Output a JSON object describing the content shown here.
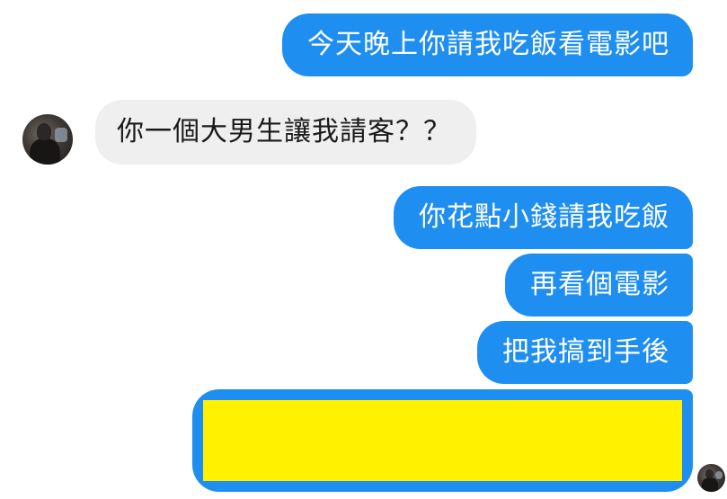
{
  "conversation": {
    "messages": [
      {
        "side": "outgoing",
        "text": "今天晚上你請我吃飯看電影吧"
      },
      {
        "side": "incoming",
        "text": "你一個大男生讓我請客？？"
      },
      {
        "side": "outgoing",
        "text": "你花點小錢請我吃飯"
      },
      {
        "side": "outgoing",
        "text": "再看個電影"
      },
      {
        "side": "outgoing",
        "text": "把我搞到手後"
      },
      {
        "side": "outgoing",
        "text": "",
        "redacted": true,
        "redaction_color": "#fff100"
      }
    ],
    "colors": {
      "outgoing_bubble": "#1f8ef1",
      "incoming_bubble": "#efefef",
      "outgoing_text": "#ffffff",
      "incoming_text": "#1a1a1a"
    }
  },
  "avatars": {
    "contact": "contact-avatar",
    "seen_indicator": "seen-avatar"
  }
}
